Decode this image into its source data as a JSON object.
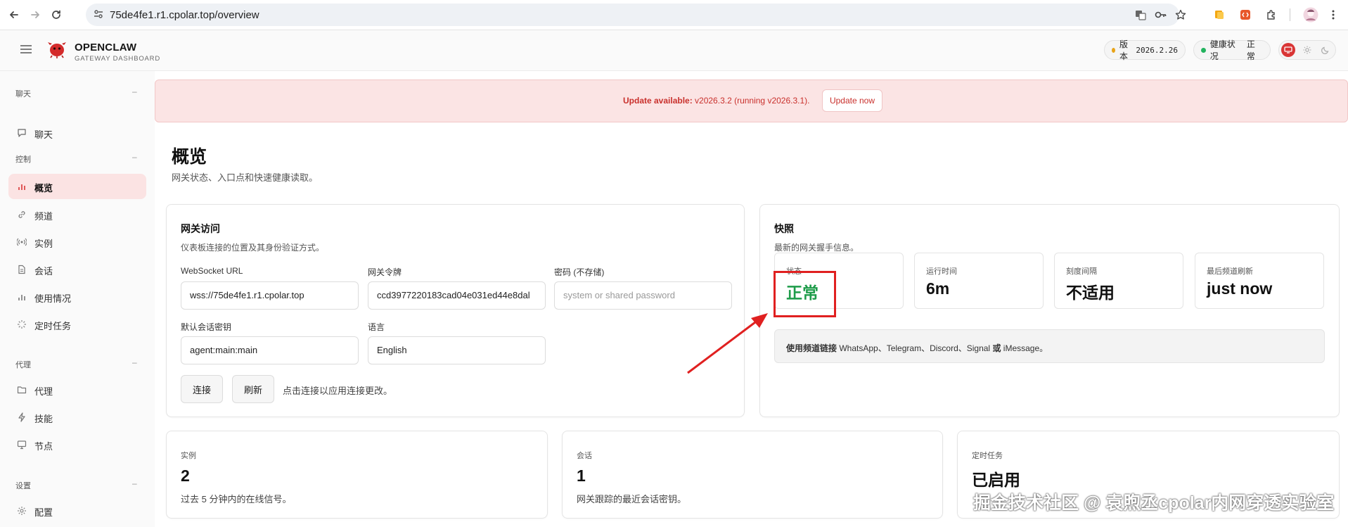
{
  "browser": {
    "url": "75de4fe1.r1.cpolar.top/overview"
  },
  "header": {
    "brand_title": "OPENCLAW",
    "brand_subtitle": "GATEWAY DASHBOARD",
    "version_label": "版本",
    "version_value": "2026.2.26",
    "health_label": "健康状况",
    "health_value": "正常",
    "colors": {
      "version_dot": "#e8a317",
      "health_dot": "#22b35e",
      "theme_active": "#d93535"
    }
  },
  "sidebar": {
    "sections": [
      {
        "title": "聊天",
        "items": [
          {
            "label": "聊天",
            "icon": "chat-icon"
          }
        ]
      },
      {
        "title": "控制",
        "items": [
          {
            "label": "概览",
            "icon": "bar-chart-icon",
            "active": true
          },
          {
            "label": "频道",
            "icon": "link-icon"
          },
          {
            "label": "实例",
            "icon": "radio-icon"
          },
          {
            "label": "会话",
            "icon": "document-icon"
          },
          {
            "label": "使用情况",
            "icon": "bar-chart-icon"
          },
          {
            "label": "定时任务",
            "icon": "loader-icon"
          }
        ]
      },
      {
        "title": "代理",
        "items": [
          {
            "label": "代理",
            "icon": "folder-icon"
          },
          {
            "label": "技能",
            "icon": "zap-icon"
          },
          {
            "label": "节点",
            "icon": "monitor-icon"
          }
        ]
      },
      {
        "title": "设置",
        "items": [
          {
            "label": "配置",
            "icon": "gear-icon"
          }
        ]
      }
    ],
    "collapse_symbol": "–"
  },
  "banner": {
    "bold": "Update available:",
    "text": " v2026.3.2 (running v2026.3.1).",
    "button": "Update now"
  },
  "page": {
    "title": "概览",
    "subtitle": "网关状态、入口点和快速健康读取。"
  },
  "gateway_card": {
    "title": "网关访问",
    "subtitle": "仪表板连接的位置及其身份验证方式。",
    "websocket_label": "WebSocket URL",
    "websocket_value": "wss://75de4fe1.r1.cpolar.top",
    "token_label": "网关令牌",
    "token_value": "ccd3977220183cad04e031ed44e8dal",
    "password_label": "密码 (不存储)",
    "password_placeholder": "system or shared password",
    "session_key_label": "默认会话密钥",
    "session_key_value": "agent:main:main",
    "language_label": "语言",
    "language_value": "English",
    "connect_button": "连接",
    "refresh_button": "刷新",
    "hint": "点击连接以应用连接更改。"
  },
  "snapshot_card": {
    "title": "快照",
    "subtitle": "最新的网关握手信息。",
    "tiles": [
      {
        "label": "状态",
        "value": "正常"
      },
      {
        "label": "运行时间",
        "value": "6m"
      },
      {
        "label": "刻度间隔",
        "value": "不适用"
      },
      {
        "label": "最后频道刷新",
        "value": "just now"
      }
    ],
    "info_prefix": "使用频道链接",
    "info_text": " WhatsApp、Telegram、Discord、Signal ",
    "info_or": "或",
    "info_end": " iMessage。"
  },
  "stats": [
    {
      "label": "实例",
      "value": "2",
      "desc": "过去 5 分钟内的在线信号。"
    },
    {
      "label": "会话",
      "value": "1",
      "desc": "网关跟踪的最近会话密钥。"
    },
    {
      "label": "定时任务",
      "value": "已启用",
      "desc": ""
    }
  ],
  "watermark": "掘金技术社区 @ 袁煦丞cpolar内网穿透实验室"
}
